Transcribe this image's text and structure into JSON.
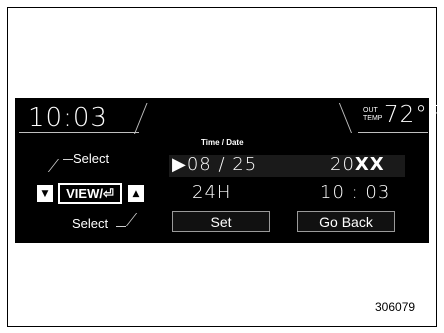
{
  "header": {
    "clock": "10:03",
    "outtemp_label_top": "OUT",
    "outtemp_label_bottom": "TEMP",
    "temperature": "72°F"
  },
  "screen": {
    "title": "Time / Date",
    "date_row": {
      "arrow": "▶",
      "date": "08 / 25",
      "year_prefix": "20",
      "year_suffix": "XX"
    },
    "time_row": {
      "format": "24H",
      "time": "10 : 03"
    },
    "buttons": {
      "set": "Set",
      "go_back": "Go Back"
    }
  },
  "controls": {
    "select_top": "Select",
    "select_bottom": "Select",
    "view": "VIEW/⏎",
    "down_arrow": "▼",
    "up_arrow": "▲"
  },
  "figure": {
    "number": "306079"
  },
  "colors": {
    "screen_bg": "#000000",
    "text": "#ffffff",
    "line": "#bfbfbf"
  }
}
